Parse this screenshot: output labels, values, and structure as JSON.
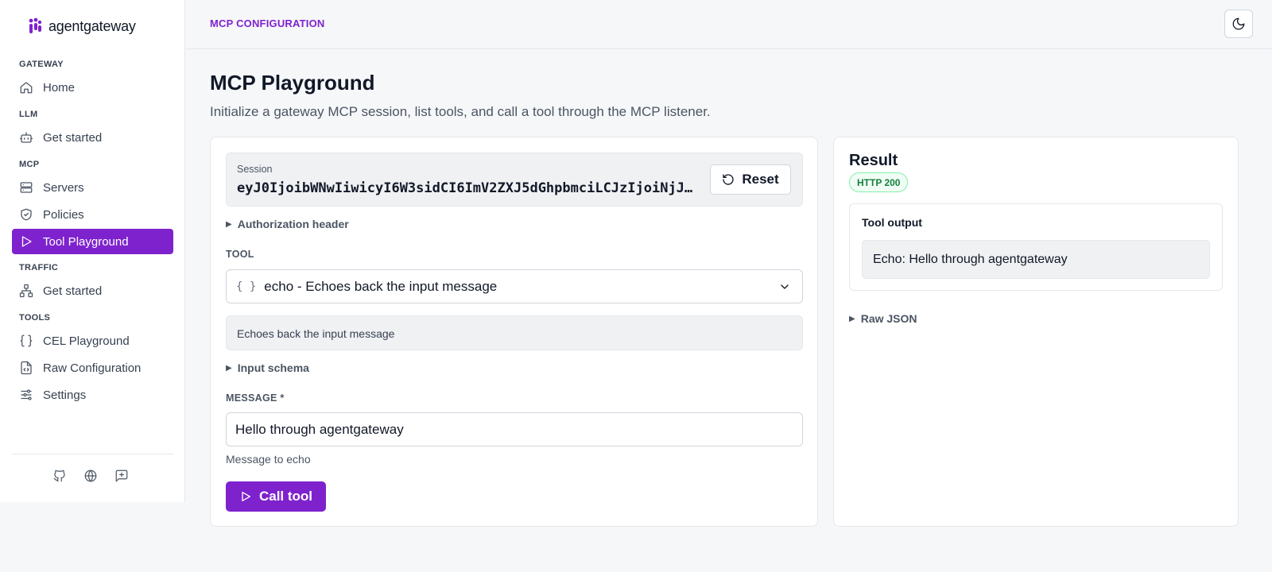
{
  "app": {
    "name": "agentgateway"
  },
  "sidebar": {
    "sections": [
      {
        "label": "GATEWAY",
        "items": [
          {
            "label": "Home",
            "icon": "home-icon"
          }
        ]
      },
      {
        "label": "LLM",
        "items": [
          {
            "label": "Get started",
            "icon": "bot-icon"
          }
        ]
      },
      {
        "label": "MCP",
        "items": [
          {
            "label": "Servers",
            "icon": "server-icon"
          },
          {
            "label": "Policies",
            "icon": "shield-icon"
          },
          {
            "label": "Tool Playground",
            "icon": "play-icon",
            "active": true
          }
        ]
      },
      {
        "label": "TRAFFIC",
        "items": [
          {
            "label": "Get started",
            "icon": "network-icon"
          }
        ]
      },
      {
        "label": "TOOLS",
        "items": [
          {
            "label": "CEL Playground",
            "icon": "braces-icon"
          },
          {
            "label": "Raw Configuration",
            "icon": "file-code-icon"
          },
          {
            "label": "Settings",
            "icon": "sliders-icon"
          }
        ]
      }
    ],
    "footer_icons": [
      "github-icon",
      "globe-icon",
      "feedback-icon"
    ]
  },
  "header": {
    "breadcrumb": "MCP CONFIGURATION",
    "theme_icon": "moon-icon"
  },
  "page": {
    "title": "MCP Playground",
    "subtitle": "Initialize a gateway MCP session, list tools, and call a tool through the MCP listener."
  },
  "session": {
    "label": "Session",
    "token": "eyJ0IjoibWNwIiwicyI6W3sidCI6ImV2ZXJ5dGhpbmciLCJzIjoiNjJ…",
    "reset_label": "Reset"
  },
  "authorization": {
    "label": "Authorization header"
  },
  "tool": {
    "label": "TOOL",
    "selected": "echo - Echoes back the input message",
    "description": "Echoes back the input message",
    "schema_label": "Input schema"
  },
  "message": {
    "label": "MESSAGE *",
    "value": "Hello through agentgateway",
    "hint": "Message to echo"
  },
  "call": {
    "label": "Call tool"
  },
  "result": {
    "title": "Result",
    "status": "HTTP 200",
    "output_label": "Tool output",
    "output_value": "Echo: Hello through agentgateway",
    "raw_label": "Raw JSON"
  },
  "colors": {
    "accent": "#7e22ce",
    "success": "#15803d"
  }
}
